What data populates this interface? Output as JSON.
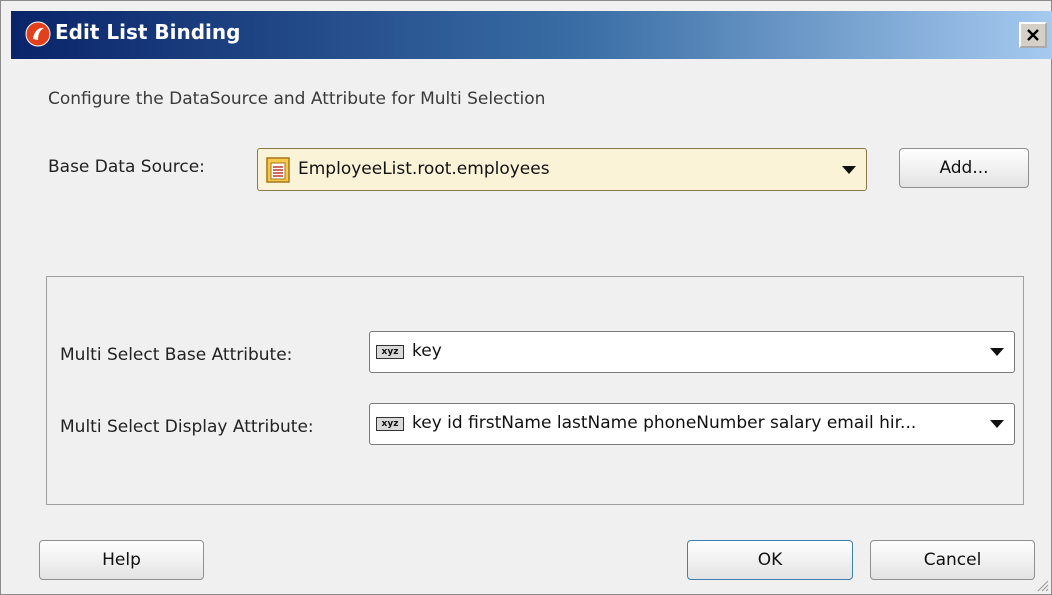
{
  "window": {
    "title": "Edit List Binding"
  },
  "dialog": {
    "instructions": "Configure the DataSource and Attribute for Multi Selection",
    "base_data_source_label": "Base Data Source:",
    "base_data_source_value": "EmployeeList.root.employees",
    "add_button": "Add...",
    "multi_base_label": "Multi Select Base Attribute:",
    "multi_base_value": "key",
    "multi_display_label": "Multi Select Display Attribute:",
    "multi_display_value": "key id firstName lastName phoneNumber salary email hir...",
    "help_button": "Help",
    "ok_button": "OK",
    "cancel_button": "Cancel"
  },
  "icons": {
    "app": "jdeveloper-app-icon",
    "datasource": "datasource-icon",
    "attribute": "attribute-xyz-icon",
    "close": "close-icon"
  }
}
